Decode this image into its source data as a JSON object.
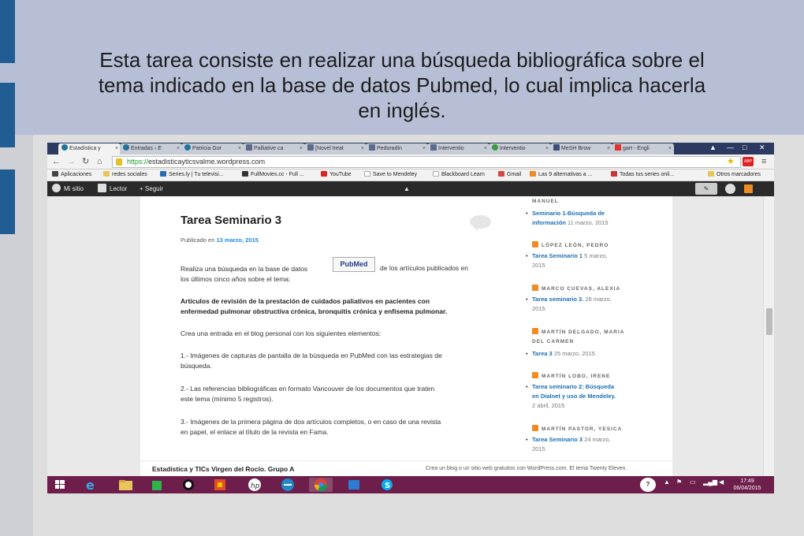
{
  "slide": {
    "text_line1": "Esta tarea consiste en realizar una búsqueda bibliográfica sobre el",
    "text_line2": "tema indicado en la base de datos Pubmed, lo cual implica hacerla",
    "text_line3": "en inglés."
  },
  "browser": {
    "tabs": [
      {
        "label": "Estadística y",
        "active": true
      },
      {
        "label": "Entradas ‹ E",
        "active": false
      },
      {
        "label": "Patricia Gor",
        "active": false
      },
      {
        "label": "Palliative ca",
        "active": false
      },
      {
        "label": "[Novel treat",
        "active": false
      },
      {
        "label": "Pedoradin",
        "active": false
      },
      {
        "label": "Interventio",
        "active": false
      },
      {
        "label": "Interventio",
        "active": false
      },
      {
        "label": "MeSH Brow",
        "active": false
      },
      {
        "label": "gart - Engli",
        "active": false
      }
    ],
    "url_scheme": "https://",
    "url_host": "estadisticayticsvalme.wordpress.com",
    "bookmarks": [
      "Aplicaciones",
      "redes sociales",
      "Series.ly | Tu televisi...",
      "FullMovies.cc - Full ...",
      "YouTube",
      "Save to Mendeley",
      "Blackboard Learn",
      "Gmail",
      "Las 9 alternativas a ...",
      "Todas tus series onli...",
      "Otros marcadores"
    ],
    "wp_toolbar": {
      "my_site": "Mi sitio",
      "reader": "Lector",
      "follow": "Seguir"
    }
  },
  "post": {
    "title": "Tarea Seminario 3",
    "published_prefix": "Publicado en",
    "published_date": "13 marzo, 2015",
    "intro_line1": "Realiza una búsqueda en la base de datos",
    "intro_after_logo": "de los artículos publicados en",
    "intro_line2": "los últimos cinco años sobre el tema:",
    "pubmed_logo": "PubMed",
    "topic_line1": "Artículos de revisión de la prestación de cuidados paliativos en pacientes con",
    "topic_line2": "enfermedad pulmonar obstructiva crónica, bronquitis crónica y enfisema pulmonar.",
    "create": "Crea una entrada en el blog personal con los siguientes elementos:",
    "item1_line1": "1.- Imágenes de capturas de pantalla de la búsqueda en PubMed con las estrategias de",
    "item1_line2": "búsqueda.",
    "item2_line1": "2.- Las referencias bibliográficas en formato Vancouver de los documentos que traten",
    "item2_line2": "este tema (mínimo 5 registros).",
    "item3_line1": "3.- Imágenes de la primera página de dos artículos completos, o en caso de una revista",
    "item3_line2": "en papel, el enlace al título de la revista en Fama."
  },
  "sidebar": {
    "top_author": "MANUEL",
    "groups": [
      {
        "author": "",
        "link": "Seminario 1-Búsqueda de",
        "link2": "información",
        "date": "11 marzo, 2015"
      },
      {
        "author": "LÓPEZ LEÓN, PEDRO",
        "link": "Tarea Seminario 1",
        "date": "5 marzo,",
        "date2": "2015"
      },
      {
        "author": "MARCO CUEVAS, ALEXIA",
        "link": "Tarea seminario 3.",
        "date": "28 marzo,",
        "date2": "2015"
      },
      {
        "author": "MARTÍN DELGADO, MARIA",
        "author2": "DEL CARMEN",
        "link": "Tarea 3",
        "date": "25 marzo, 2015"
      },
      {
        "author": "MARTÍN LOBO, IRENE",
        "link": "Tarea seminario 2: Búsqueda",
        "link2": "en Dialnet y uso de Mendeley.",
        "date": "2 abril, 2015"
      },
      {
        "author": "MARTÍN PASTOR, YESICA",
        "link": "Tarea Seminario 3",
        "date": "24 marzo,",
        "date2": "2015"
      }
    ]
  },
  "footer": {
    "left": "Estadística y TICs Virgen del Rocío. Grupo A",
    "right": "Crea un blog o un sitio web gratuitos con WordPress.com. El tema Twenty Eleven."
  },
  "taskbar": {
    "time": "17:49",
    "date": "06/04/2015"
  },
  "colors": {
    "link_blue": "#1b6fb6",
    "taskbar": "#6d1e4a",
    "slide_blue": "#b6bfd6",
    "deco_bar": "#1f5d92"
  }
}
